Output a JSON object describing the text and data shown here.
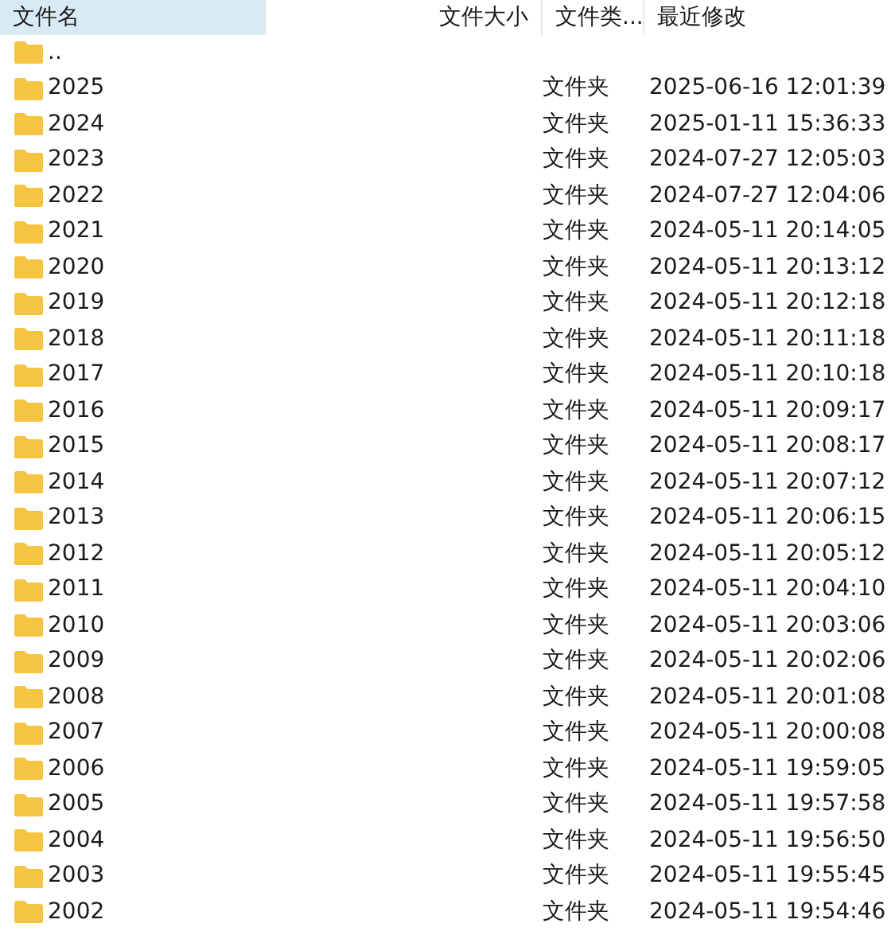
{
  "columns": [
    {
      "label": "文件名",
      "selected": true
    },
    {
      "label": "文件大小",
      "selected": false
    },
    {
      "label": "文件类...",
      "selected": false
    },
    {
      "label": "最近修改",
      "selected": false
    }
  ],
  "rows": [
    {
      "name": "..",
      "type": "",
      "modified": ""
    },
    {
      "name": "2025",
      "type": "文件夹",
      "modified": "2025-06-16 12:01:39"
    },
    {
      "name": "2024",
      "type": "文件夹",
      "modified": "2025-01-11 15:36:33"
    },
    {
      "name": "2023",
      "type": "文件夹",
      "modified": "2024-07-27 12:05:03"
    },
    {
      "name": "2022",
      "type": "文件夹",
      "modified": "2024-07-27 12:04:06"
    },
    {
      "name": "2021",
      "type": "文件夹",
      "modified": "2024-05-11 20:14:05"
    },
    {
      "name": "2020",
      "type": "文件夹",
      "modified": "2024-05-11 20:13:12"
    },
    {
      "name": "2019",
      "type": "文件夹",
      "modified": "2024-05-11 20:12:18"
    },
    {
      "name": "2018",
      "type": "文件夹",
      "modified": "2024-05-11 20:11:18"
    },
    {
      "name": "2017",
      "type": "文件夹",
      "modified": "2024-05-11 20:10:18"
    },
    {
      "name": "2016",
      "type": "文件夹",
      "modified": "2024-05-11 20:09:17"
    },
    {
      "name": "2015",
      "type": "文件夹",
      "modified": "2024-05-11 20:08:17"
    },
    {
      "name": "2014",
      "type": "文件夹",
      "modified": "2024-05-11 20:07:12"
    },
    {
      "name": "2013",
      "type": "文件夹",
      "modified": "2024-05-11 20:06:15"
    },
    {
      "name": "2012",
      "type": "文件夹",
      "modified": "2024-05-11 20:05:12"
    },
    {
      "name": "2011",
      "type": "文件夹",
      "modified": "2024-05-11 20:04:10"
    },
    {
      "name": "2010",
      "type": "文件夹",
      "modified": "2024-05-11 20:03:06"
    },
    {
      "name": "2009",
      "type": "文件夹",
      "modified": "2024-05-11 20:02:06"
    },
    {
      "name": "2008",
      "type": "文件夹",
      "modified": "2024-05-11 20:01:08"
    },
    {
      "name": "2007",
      "type": "文件夹",
      "modified": "2024-05-11 20:00:08"
    },
    {
      "name": "2006",
      "type": "文件夹",
      "modified": "2024-05-11 19:59:05"
    },
    {
      "name": "2005",
      "type": "文件夹",
      "modified": "2024-05-11 19:57:58"
    },
    {
      "name": "2004",
      "type": "文件夹",
      "modified": "2024-05-11 19:56:50"
    },
    {
      "name": "2003",
      "type": "文件夹",
      "modified": "2024-05-11 19:55:45"
    },
    {
      "name": "2002",
      "type": "文件夹",
      "modified": "2024-05-11 19:54:46"
    }
  ]
}
